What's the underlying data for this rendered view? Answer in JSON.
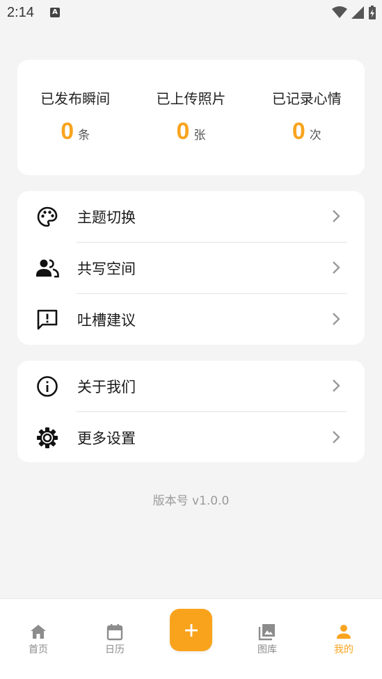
{
  "status_bar": {
    "time": "2:14",
    "badge": "A"
  },
  "stats": [
    {
      "label": "已发布瞬间",
      "value": "0",
      "unit": "条"
    },
    {
      "label": "已上传照片",
      "value": "0",
      "unit": "张"
    },
    {
      "label": "已记录心情",
      "value": "0",
      "unit": "次"
    }
  ],
  "menu_group_1": [
    {
      "label": "主题切换",
      "icon": "palette-icon"
    },
    {
      "label": "共写空间",
      "icon": "people-icon"
    },
    {
      "label": "吐槽建议",
      "icon": "feedback-icon"
    }
  ],
  "menu_group_2": [
    {
      "label": "关于我们",
      "icon": "info-icon"
    },
    {
      "label": "更多设置",
      "icon": "gear-icon"
    }
  ],
  "version": "版本号 v1.0.0",
  "nav": {
    "home": "首页",
    "calendar": "日历",
    "gallery": "图库",
    "mine": "我的"
  },
  "colors": {
    "accent": "#f9a41f",
    "background": "#f4f4f4"
  }
}
